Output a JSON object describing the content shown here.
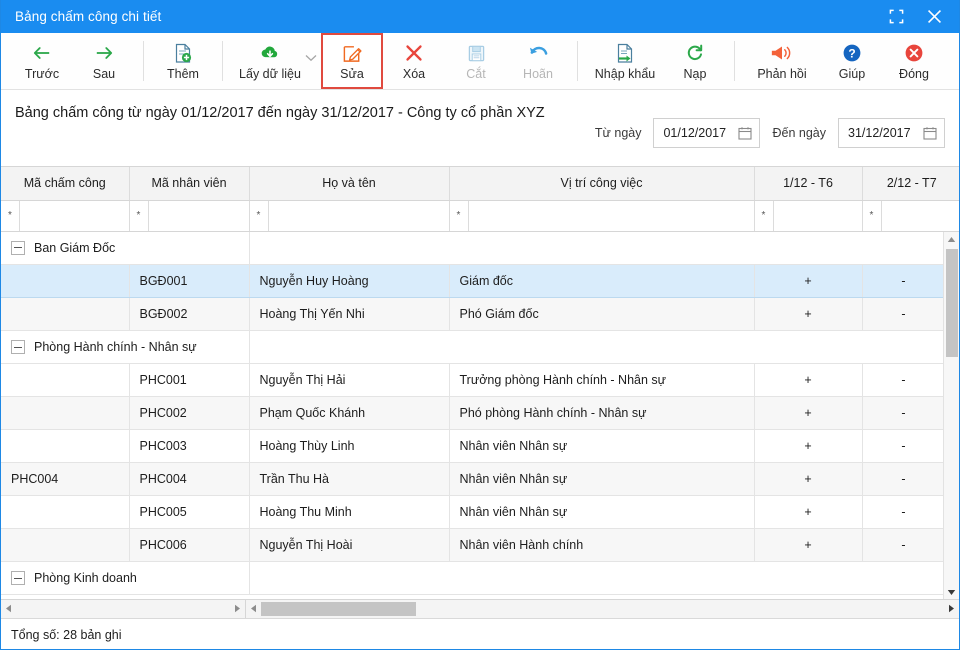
{
  "window": {
    "title": "Bảng chấm công chi tiết",
    "restore_icon": "restore-window-icon",
    "close_icon": "close-icon",
    "accent": "#1a8cf0"
  },
  "toolbar": {
    "items": [
      {
        "label": "Trước",
        "icon": "arrow-left-icon",
        "color": "#2ba84a",
        "state": "enabled"
      },
      {
        "label": "Sau",
        "icon": "arrow-right-icon",
        "color": "#2ba84a",
        "state": "enabled"
      },
      {
        "label": "Thêm",
        "icon": "document-add-icon",
        "color": "#2ba84a",
        "state": "enabled"
      },
      {
        "label": "Lấy dữ liệu",
        "icon": "cloud-download-icon",
        "color": "#22a83c",
        "state": "enabled",
        "has_dropdown": true
      },
      {
        "label": "Sửa",
        "icon": "edit-pencil-icon",
        "color": "#f06a22",
        "state": "selected"
      },
      {
        "label": "Xóa",
        "icon": "delete-x-icon",
        "color": "#e8453c",
        "state": "enabled"
      },
      {
        "label": "Cắt",
        "icon": "save-floppy-icon",
        "color": "#b9d4e8",
        "state": "disabled"
      },
      {
        "label": "Hoãn",
        "icon": "undo-arrow-icon",
        "color": "#3b9fe0",
        "state": "disabled"
      },
      {
        "label": "Nhập khẩu",
        "icon": "import-file-icon",
        "color": "#2ba84a",
        "state": "enabled"
      },
      {
        "label": "Nạp",
        "icon": "refresh-icon",
        "color": "#2ba84a",
        "state": "enabled"
      },
      {
        "label": "Phản hồi",
        "icon": "megaphone-icon",
        "color": "#f4623a",
        "state": "enabled"
      },
      {
        "label": "Giúp",
        "icon": "help-question-icon",
        "color": "#1565c0",
        "state": "enabled"
      },
      {
        "label": "Đóng",
        "icon": "close-circle-icon",
        "color": "#e8453c",
        "state": "enabled"
      }
    ]
  },
  "report": {
    "title": "Bảng chấm công từ ngày 01/12/2017 đến ngày 31/12/2017 - Công ty cổ phần XYZ",
    "from_label": "Từ ngày",
    "from_value": "01/12/2017",
    "to_label": "Đến ngày",
    "to_value": "31/12/2017",
    "calendar_icon": "calendar-icon"
  },
  "grid": {
    "columns": [
      "Mã chấm công",
      "Mã nhân viên",
      "Họ và tên",
      "Vị trí công việc",
      "1/12 - T6",
      "2/12 - T7"
    ],
    "filter_operator": "*",
    "filter_values": [
      "",
      "",
      "",
      "",
      "",
      ""
    ],
    "rows": [
      {
        "type": "group",
        "label": "Ban Giám Đốc",
        "expanded": true
      },
      {
        "type": "data",
        "selected": true,
        "cells": [
          "",
          "BGĐ001",
          "Nguyễn Huy Hoàng",
          "Giám đốc",
          "+",
          "-"
        ]
      },
      {
        "type": "data",
        "alt": true,
        "cells": [
          "",
          "BGĐ002",
          "Hoàng Thị Yến Nhi",
          "Phó Giám đốc",
          "+",
          "-"
        ]
      },
      {
        "type": "group",
        "label": "Phòng Hành chính - Nhân sự",
        "expanded": true
      },
      {
        "type": "data",
        "cells": [
          "",
          "PHC001",
          "Nguyễn Thị Hải",
          "Trưởng phòng Hành chính - Nhân sự",
          "+",
          "-"
        ]
      },
      {
        "type": "data",
        "alt": true,
        "cells": [
          "",
          "PHC002",
          "Phạm Quốc Khánh",
          "Phó phòng Hành chính - Nhân sự",
          "+",
          "-"
        ]
      },
      {
        "type": "data",
        "cells": [
          "",
          "PHC003",
          "Hoàng Thùy Linh",
          "Nhân viên Nhân sự",
          "+",
          "-"
        ]
      },
      {
        "type": "data",
        "alt": true,
        "cells": [
          "PHC004",
          "PHC004",
          "Trần Thu Hà",
          "Nhân viên Nhân sự",
          "+",
          "-"
        ]
      },
      {
        "type": "data",
        "cells": [
          "",
          "PHC005",
          "Hoàng Thu Minh",
          "Nhân viên Nhân sự",
          "+",
          "-"
        ]
      },
      {
        "type": "data",
        "alt": true,
        "cells": [
          "",
          "PHC006",
          "Nguyễn Thị Hoài",
          "Nhân viên Hành chính",
          "+",
          "-"
        ]
      },
      {
        "type": "group",
        "label": "Phòng Kinh doanh",
        "expanded": true
      }
    ]
  },
  "status": {
    "total_text": "Tổng số: 28 bản ghi"
  }
}
